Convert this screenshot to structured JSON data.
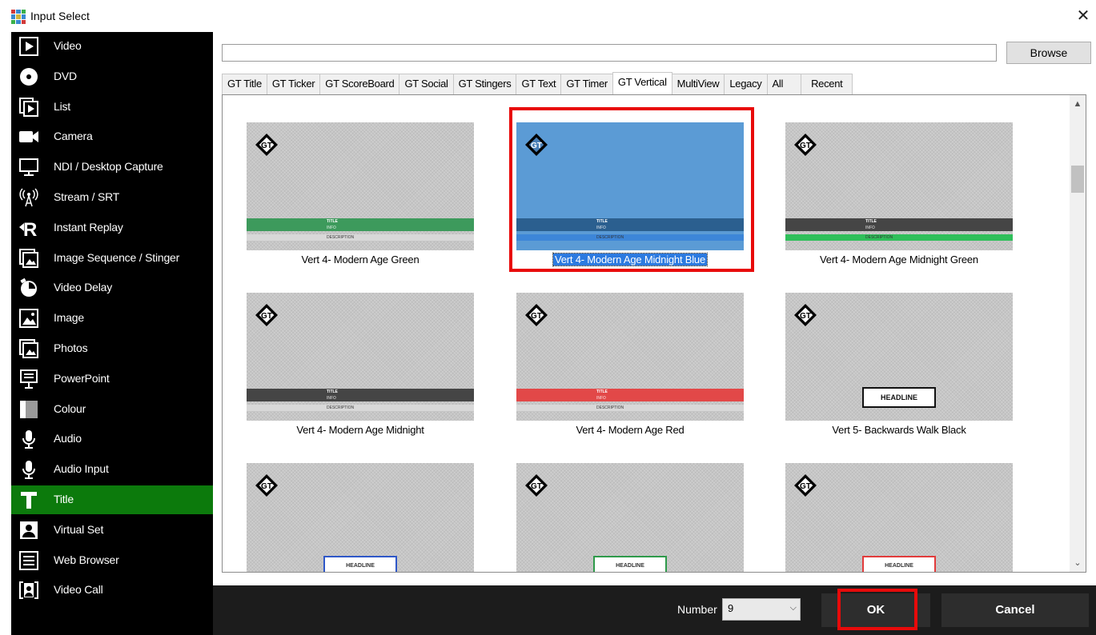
{
  "window": {
    "title": "Input Select",
    "close_glyph": "✕"
  },
  "sidebar": {
    "items": [
      {
        "label": "Video",
        "icon": "video-icon"
      },
      {
        "label": "DVD",
        "icon": "dvd-icon"
      },
      {
        "label": "List",
        "icon": "list-icon"
      },
      {
        "label": "Camera",
        "icon": "camera-icon"
      },
      {
        "label": "NDI / Desktop Capture",
        "icon": "monitor-icon"
      },
      {
        "label": "Stream / SRT",
        "icon": "antenna-icon"
      },
      {
        "label": "Instant Replay",
        "icon": "replay-icon"
      },
      {
        "label": "Image Sequence / Stinger",
        "icon": "image-sequence-icon"
      },
      {
        "label": "Video Delay",
        "icon": "timer-icon"
      },
      {
        "label": "Image",
        "icon": "image-icon"
      },
      {
        "label": "Photos",
        "icon": "photos-icon"
      },
      {
        "label": "PowerPoint",
        "icon": "presentation-icon"
      },
      {
        "label": "Colour",
        "icon": "colour-icon"
      },
      {
        "label": "Audio",
        "icon": "microphone-icon"
      },
      {
        "label": "Audio Input",
        "icon": "microphone-icon"
      },
      {
        "label": "Title",
        "icon": "title-icon",
        "active": true
      },
      {
        "label": "Virtual Set",
        "icon": "person-icon"
      },
      {
        "label": "Web Browser",
        "icon": "browser-icon"
      },
      {
        "label": "Video Call",
        "icon": "video-call-icon"
      }
    ],
    "active_color": "#0c7a0c"
  },
  "toolbar": {
    "path_value": "",
    "browse_label": "Browse"
  },
  "tabs": [
    {
      "label": "GT Title"
    },
    {
      "label": "GT Ticker"
    },
    {
      "label": "GT ScoreBoard"
    },
    {
      "label": "GT Social"
    },
    {
      "label": "GT Stingers"
    },
    {
      "label": "GT Text"
    },
    {
      "label": "GT Timer"
    },
    {
      "label": "GT Vertical",
      "active": true
    },
    {
      "label": "MultiView"
    },
    {
      "label": "Legacy"
    },
    {
      "label": "All"
    },
    {
      "label": "Recent"
    }
  ],
  "tiles": [
    {
      "label": "Vert 4- Modern Age Green",
      "style": "bar",
      "bar_color": "#3d9a5c",
      "stripe_color": "#d8d8d8",
      "bar_text": "TITLE",
      "sub_text": "INFO",
      "desc_text": "DESCRIPTION"
    },
    {
      "label": "Vert 4- Modern Age Midnight Blue",
      "style": "bar",
      "bar_color": "#2b5f8f",
      "stripe_color": "#3d86d8",
      "bar_text": "TITLE",
      "sub_text": "INFO",
      "desc_text": "DESCRIPTION",
      "selected": true
    },
    {
      "label": "Vert 4- Modern Age Midnight Green",
      "style": "bar",
      "bar_color": "#454545",
      "stripe_color": "#2fbf5a",
      "bar_text": "TITLE",
      "sub_text": "INFO",
      "desc_text": "DESCRIPTION"
    },
    {
      "label": "Vert 4- Modern Age Midnight",
      "style": "bar",
      "bar_color": "#454545",
      "stripe_color": "#d8d8d8",
      "bar_text": "TITLE",
      "sub_text": "INFO",
      "desc_text": "DESCRIPTION"
    },
    {
      "label": "Vert 4- Modern Age Red",
      "style": "bar",
      "bar_color": "#e24848",
      "stripe_color": "#d8d8d8",
      "bar_text": "TITLE",
      "sub_text": "INFO",
      "desc_text": "DESCRIPTION"
    },
    {
      "label": "Vert 5- Backwards Walk Black",
      "style": "headline",
      "headline_text": "HEADLINE",
      "border_color": "#111111"
    },
    {
      "label": "",
      "style": "headline-partial",
      "headline_text": "HEADLINE",
      "border_color": "#2e57c8"
    },
    {
      "label": "",
      "style": "headline-partial",
      "headline_text": "HEADLINE",
      "border_color": "#2e9a4a"
    },
    {
      "label": "",
      "style": "headline-partial",
      "headline_text": "HEADLINE",
      "border_color": "#e23b3b"
    }
  ],
  "logo_text": "GT",
  "footer": {
    "number_label": "Number",
    "number_value": "9",
    "ok_label": "OK",
    "cancel_label": "Cancel"
  },
  "colors": {
    "highlight": "#e80a0a",
    "selection": "#2c7ae0"
  }
}
